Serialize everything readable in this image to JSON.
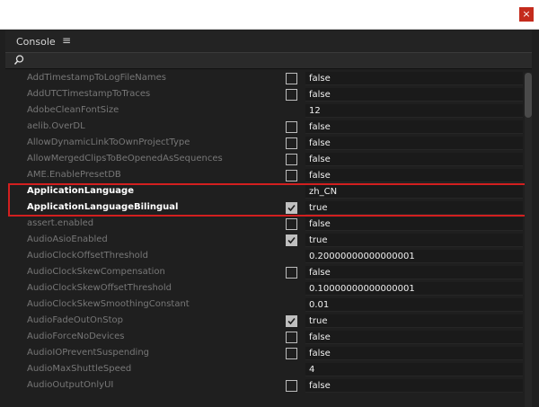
{
  "window": {
    "close_glyph": "×"
  },
  "panel": {
    "title": "Console",
    "menu_glyph": "≡"
  },
  "icons": {
    "search": "search-icon",
    "close": "close-icon",
    "menu": "hamburger-icon"
  },
  "rows": [
    {
      "name": "AddTimestampToLogFileNames",
      "value": "false",
      "checkbox": "unchecked"
    },
    {
      "name": "AddUTCTimestampToTraces",
      "value": "false",
      "checkbox": "unchecked"
    },
    {
      "name": "AdobeCleanFontSize",
      "value": "12",
      "checkbox": "none"
    },
    {
      "name": "aelib.OverDL",
      "value": "false",
      "checkbox": "unchecked"
    },
    {
      "name": "AllowDynamicLinkToOwnProjectType",
      "value": "false",
      "checkbox": "unchecked"
    },
    {
      "name": "AllowMergedClipsToBeOpenedAsSequences",
      "value": "false",
      "checkbox": "unchecked"
    },
    {
      "name": "AME.EnablePresetDB",
      "value": "false",
      "checkbox": "unchecked"
    },
    {
      "name": "ApplicationLanguage",
      "value": "zh_CN",
      "checkbox": "none",
      "highlighted": true
    },
    {
      "name": "ApplicationLanguageBilingual",
      "value": "true",
      "checkbox": "checked",
      "highlighted": true
    },
    {
      "name": "assert.enabled",
      "value": "false",
      "checkbox": "unchecked"
    },
    {
      "name": "AudioAsioEnabled",
      "value": "true",
      "checkbox": "checked"
    },
    {
      "name": "AudioClockOffsetThreshold",
      "value": "0.20000000000000001",
      "checkbox": "none"
    },
    {
      "name": "AudioClockSkewCompensation",
      "value": "false",
      "checkbox": "unchecked"
    },
    {
      "name": "AudioClockSkewOffsetThreshold",
      "value": "0.10000000000000001",
      "checkbox": "none"
    },
    {
      "name": "AudioClockSkewSmoothingConstant",
      "value": "0.01",
      "checkbox": "none"
    },
    {
      "name": "AudioFadeOutOnStop",
      "value": "true",
      "checkbox": "checked"
    },
    {
      "name": "AudioForceNoDevices",
      "value": "false",
      "checkbox": "unchecked"
    },
    {
      "name": "AudioIOPreventSuspending",
      "value": "false",
      "checkbox": "unchecked"
    },
    {
      "name": "AudioMaxShuttleSpeed",
      "value": "4",
      "checkbox": "none"
    },
    {
      "name": "AudioOutputOnlyUI",
      "value": "false",
      "checkbox": "unchecked"
    }
  ],
  "colors": {
    "highlight_border": "#d21f1f",
    "close_button": "#c42b1c"
  }
}
